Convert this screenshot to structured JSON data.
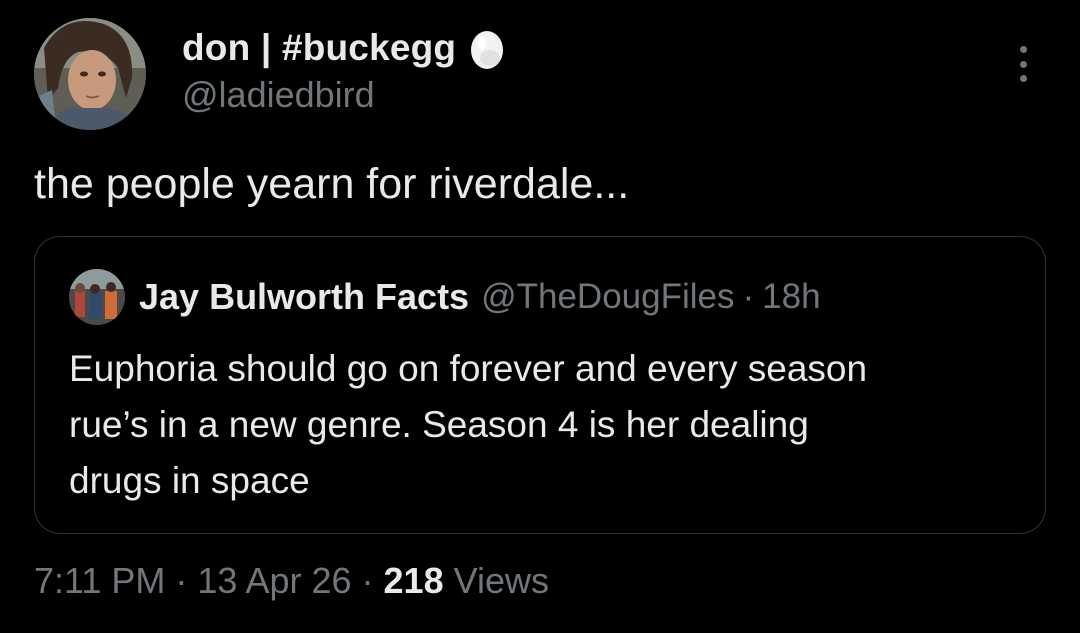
{
  "tweet": {
    "display_name": "don | #buckegg",
    "handle": "@ladiedbird",
    "text": "the people yearn for riverdale...",
    "avatar_icon": "profile-photo",
    "badge_icon": "egg-icon",
    "more_icon": "more-options-icon"
  },
  "quote": {
    "name": "Jay Bulworth Facts",
    "handle": "@TheDougFiles",
    "separator": "·",
    "time": "18h",
    "text_lines": [
      "Euphoria should go on forever and every season",
      "rue’s in a new genre. Season 4 is her dealing",
      "drugs in space"
    ]
  },
  "meta": {
    "time": "7:11 PM",
    "separator": "·",
    "date": "13 Apr 26",
    "views_count": "218",
    "views_label": "Views"
  },
  "colors": {
    "background": "#000000",
    "text_primary": "#e7e9ea",
    "text_secondary": "#71767b",
    "border": "#2f3336"
  }
}
